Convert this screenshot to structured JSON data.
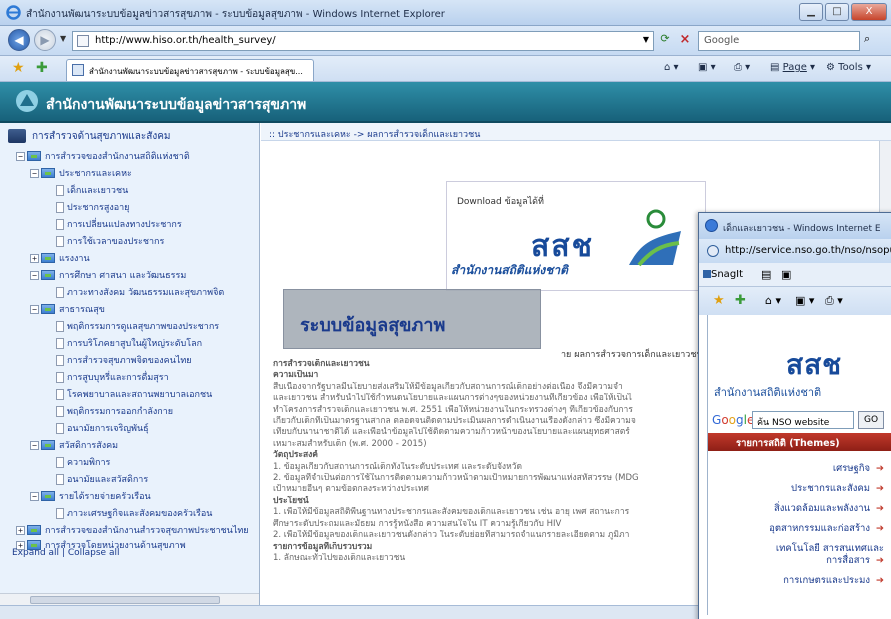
{
  "window": {
    "title": "สำนักงานพัฒนาระบบข้อมูลข่าวสารสุขภาพ - ระบบข้อมูลสุขภาพ - Windows Internet Explorer",
    "btn_min": "▁",
    "btn_max": "□",
    "btn_close": "X"
  },
  "address": {
    "url": "http://www.hiso.or.th/health_survey/",
    "search_placeholder": "Google",
    "back_label": "◀",
    "forward_label": "▶"
  },
  "tabbar": {
    "tab_label": "สำนักงานพัฒนาระบบข้อมูลข่าวสารสุขภาพ - ระบบข้อมูลสุข...",
    "page_menu": "Page",
    "tools_menu": "Tools"
  },
  "banner": {
    "title": "สำนักงานพัฒนาระบบข้อมูลข่าวสารสุขภาพ"
  },
  "tree": {
    "root": "การสำรวจด้านสุขภาพและสังคม",
    "nodes": [
      {
        "label": "การสำรวจของสำนักงานสถิติแห่งชาติ"
      },
      {
        "label": "ประชากรและเคหะ"
      },
      {
        "label": "เด็กและเยาวชน"
      },
      {
        "label": "ประชากรสูงอายุ"
      },
      {
        "label": "การเปลี่ยนแปลงทางประชากร"
      },
      {
        "label": "การใช้เวลาของประชากร"
      },
      {
        "label": "แรงงาน"
      },
      {
        "label": "การศึกษา ศาสนา และวัฒนธรรม"
      },
      {
        "label": "ภาวะทางสังคม วัฒนธรรมและสุขภาพจิต"
      },
      {
        "label": "สาธารณสุข"
      },
      {
        "label": "พฤติกรรมการดูแลสุขภาพของประชากร"
      },
      {
        "label": "การบริโภคยาสูบในผู้ใหญ่ระดับโลก"
      },
      {
        "label": "การสำรวจสุขภาพจิตของคนไทย"
      },
      {
        "label": "การสูบบุหรี่และการดื่มสุรา"
      },
      {
        "label": "โรคพยาบาลและสถานพยาบาลเอกชน"
      },
      {
        "label": "พฤติกรรมการออกกำลังกาย"
      },
      {
        "label": "อนามัยการเจริญพันธุ์"
      },
      {
        "label": "สวัสดิการสังคม"
      },
      {
        "label": "ความพิการ"
      },
      {
        "label": "อนามัยและสวัสดิการ"
      },
      {
        "label": "รายได้รายจ่ายครัวเรือน"
      },
      {
        "label": "ภาวะเศรษฐกิจและสังคมของครัวเรือน"
      },
      {
        "label": "การสำรวจของสำนักงานสำรวจสุขภาพประชาชนไทย"
      },
      {
        "label": "การสำรวจโดยหน่วยงานด้านสุขภาพ"
      }
    ],
    "expand_all": "Expand all",
    "separator": "|",
    "collapse_all": "Collapse all"
  },
  "content": {
    "breadcrumb": ":: ประชากรและเคหะ -> ผลการสำรวจเด็กและเยาวชน",
    "download_label": "Download ข้อมูลได้ที่",
    "nso_logo_text": "สสช",
    "nso_name": "สำนักงานสถิติแห่งชาติ",
    "overlay": "ระบบข้อมูลสุขภาพ",
    "heading": "าย ผลการสำรวจการเด็กและเยาวชน",
    "article": [
      {
        "text": "การสำรวจเด็กและเยาวชน",
        "h": true
      },
      {
        "text": "ความเป็นมา",
        "h": true
      },
      {
        "text": "   สืบเนื่องจากรัฐบาลมีนโยบายส่งเสริมให้มีข้อมูลเกี่ยวกับสถานการณ์เด็กอย่างต่อเนื่อง จึงมีความจำ",
        "h": false
      },
      {
        "text": "และเยาวชน สำหรับนำไปใช้กำหนดนโยบายและแผนการต่างๆของหน่วยงานที่เกี่ยวข้อง เพื่อให้เป็นไ",
        "h": false
      },
      {
        "text": "ทำโครงการสำรวจเด็กและเยาวชน พ.ศ. 2551 เพื่อให้หน่วยงานในกระทรวงต่างๆ ที่เกี่ยวข้องกับการ",
        "h": false
      },
      {
        "text": "เกี่ยวกับเด็กที่เป็นมาตรฐานสากล ตลอดจนติดตามประเมินผลการดำเนินงานเรื่องดังกล่าว ซึ่งมีความจ",
        "h": false
      },
      {
        "text": "เทียบกับนานาชาติได้ และเพื่อนำข้อมูลไปใช้ติดตามความก้าวหน้าของนโยบายและแผนยุทธศาสตร์",
        "h": false
      },
      {
        "text": "เหมาะสมสำหรับเด็ก (พ.ศ. 2000 - 2015)",
        "h": false
      },
      {
        "text": "วัตถุประสงค์",
        "h": true
      },
      {
        "text": "1. ข้อมูลเกี่ยวกับสถานการณ์เด็กทั้งในระดับประเทศ และระดับจังหวัด",
        "h": false
      },
      {
        "text": "2. ข้อมูลที่จำเป็นต่อการใช้ในการติดตามความก้าวหน้าตามเป้าหมายการพัฒนาแห่งสหัสวรรษ (MDG",
        "h": false
      },
      {
        "text": "เป้าหมายอื่นๆ ตามข้อตกลงระหว่างประเทศ",
        "h": false
      },
      {
        "text": "ประโยชน์",
        "h": true
      },
      {
        "text": "1. เพื่อให้มีข้อมูลสถิติพื้นฐานทางประชากรและสังคมของเด็กและเยาวชน เช่น อายุ เพศ สถานะการ",
        "h": false
      },
      {
        "text": "ศึกษาระดับประถมและมัธยม การรู้หนังสือ ความสนใจใน IT ความรู้เกี่ยวกับ HIV",
        "h": false
      },
      {
        "text": "2. เพื่อให้มีข้อมูลของเด็กและเยาวชนดังกล่าว ในระดับย่อยที่สามารถจำแนกรายละเอียดตาม ภูมิภา",
        "h": false
      },
      {
        "text": "รายการข้อมูลที่เก็บรวบรวม",
        "h": true
      },
      {
        "text": "1. ลักษณะทั่วไปของเด็กและเยาวชน",
        "h": false
      }
    ]
  },
  "window2": {
    "title": "เด็กและเยาวชน - Windows Internet E",
    "url": "http://service.nso.go.th/nso/nsopu",
    "snagit": "SnagIt",
    "logo_text": "สสช",
    "org_name": "สำนักงานสถิติแห่งชาติ",
    "google_search_value": "ค้น NSO website",
    "go_button": "GO",
    "themes_title": "รายการสถิติ (Themes)",
    "themes": [
      "เศรษฐกิจ",
      "ประชากรและสังคม",
      "สิ่งแวดล้อมและพลังงาน",
      "อุตสาหกรรมและก่อสร้าง",
      "เทคโนโลยี สารสนเทศและ",
      "การสื่อสาร",
      "การเกษตรและประมง"
    ]
  }
}
